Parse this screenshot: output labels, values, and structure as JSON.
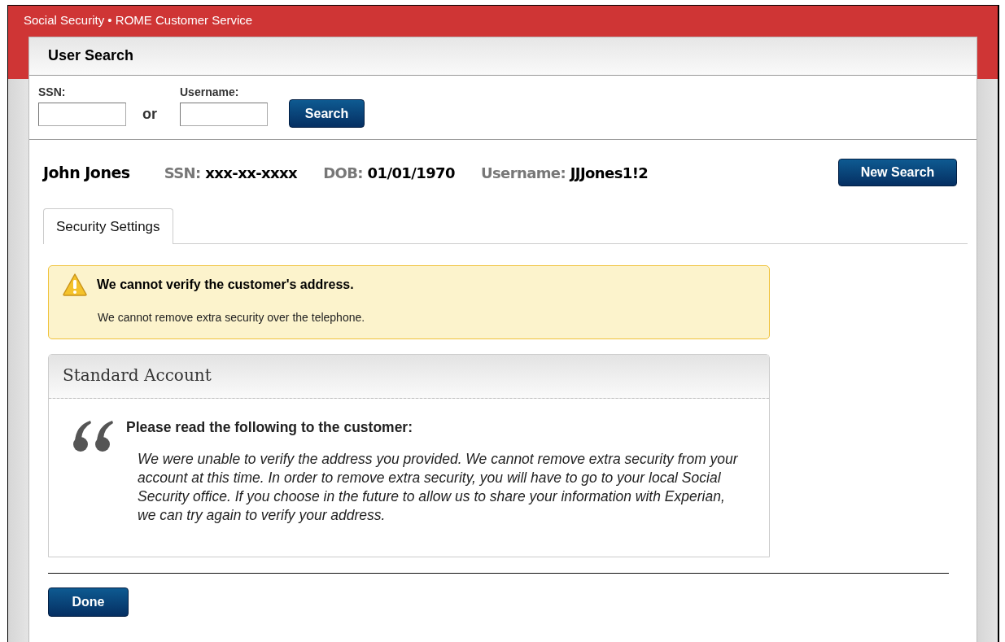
{
  "app_title": "Social Security • ROME Customer Service",
  "dialog_title": "User Search",
  "search": {
    "fields": [
      {
        "label": "SSN:"
      },
      {
        "label": "Username:"
      }
    ],
    "or_text": "or",
    "button": "Search"
  },
  "customer": {
    "name": "John Jones",
    "details": [
      {
        "label": "SSN:",
        "value": "xxx-xx-xxxx"
      },
      {
        "label": "DOB:",
        "value": "01/01/1970"
      },
      {
        "label": "Username:",
        "value": "JJJones1!2"
      }
    ],
    "button": "New Search"
  },
  "tabs": [
    {
      "label": "Security Settings",
      "selected": true
    }
  ],
  "alert": {
    "title": "We cannot verify the customer's address.",
    "message": "We cannot remove extra security over the telephone."
  },
  "panel": {
    "title": "Standard Account",
    "prompt": "Please read the following to the customer:",
    "script": "We were unable to verify the address you provided.  We cannot remove extra security from your account at this time. In order to remove extra security, you will have to go to your local Social Security office. If you choose in the future to allow us to share your information with Experian, we can try again to verify your address."
  },
  "done_button": "Done"
}
